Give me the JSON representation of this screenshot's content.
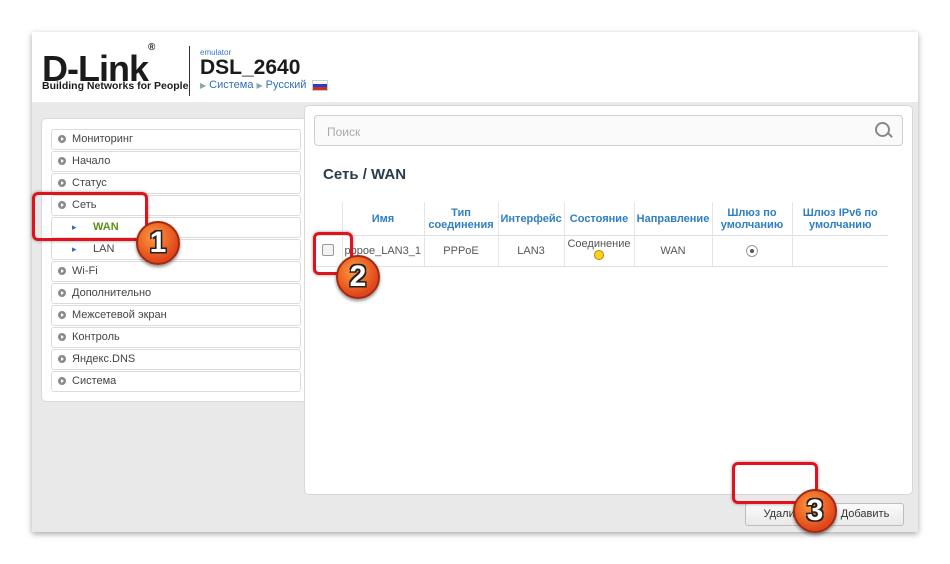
{
  "header": {
    "logo_text": "D-Link",
    "logo_reg": "®",
    "tagline": "Building Networks for People",
    "emulator_label": "emulator",
    "model": "DSL_2640",
    "crumb_system": "Система",
    "crumb_language": "Русский"
  },
  "sidebar": {
    "items": [
      {
        "label": "Мониторинг"
      },
      {
        "label": "Начало"
      },
      {
        "label": "Статус"
      },
      {
        "label": "Сеть"
      },
      {
        "label": "WAN"
      },
      {
        "label": "LAN"
      },
      {
        "label": "Wi-Fi"
      },
      {
        "label": "Дополнительно"
      },
      {
        "label": "Межсетевой экран"
      },
      {
        "label": "Контроль"
      },
      {
        "label": "Яндекс.DNS"
      },
      {
        "label": "Система"
      }
    ]
  },
  "search": {
    "placeholder": "Поиск"
  },
  "page": {
    "title": "Сеть /  WAN"
  },
  "table": {
    "headers": [
      "",
      "Имя",
      "Тип соединения",
      "Интерфейс",
      "Состояние",
      "Направление",
      "Шлюз по умолчанию",
      "Шлюз IPv6 по умолчанию"
    ],
    "rows": [
      {
        "name": "pppoe_LAN3_1",
        "type": "PPPoE",
        "interface": "LAN3",
        "state": "Соединение",
        "direction": "WAN",
        "ipv6_gateway": ""
      }
    ]
  },
  "buttons": {
    "delete": "Удалить",
    "add": "Добавить"
  },
  "annotations": [
    "1",
    "2",
    "3"
  ],
  "colors": {
    "accent_red": "#e0131c",
    "link_blue": "#2f7fc1",
    "active_green": "#5a8f1a",
    "status_yellow": "#ffd21f"
  }
}
